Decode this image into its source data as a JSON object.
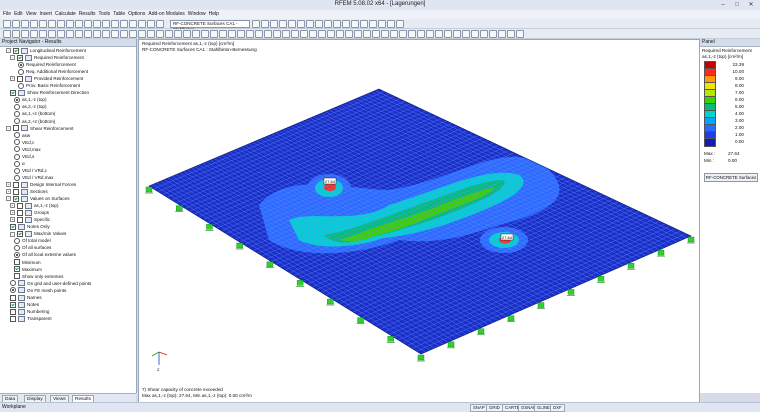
{
  "window": {
    "title": "RFEM 5.08.02 x64 - [Lagerungen]",
    "btn_min": "–",
    "btn_max": "□",
    "btn_close": "✕"
  },
  "menu": [
    "File",
    "Edit",
    "View",
    "Insert",
    "Calculate",
    "Results",
    "Tools",
    "Table",
    "Options",
    "Add-on Modules",
    "Window",
    "Help"
  ],
  "toolbar": {
    "case_combo": "RF-CONCRETE Surfaces CA1 - Stahlbeton"
  },
  "navigator": {
    "title": "Project Navigator - Results",
    "rows": [
      {
        "label": "Longitudinal Reinforcement",
        "kind": "chk",
        "on": true,
        "indent": 1,
        "expand": "−"
      },
      {
        "label": "Required Reinforcement",
        "kind": "chk",
        "on": true,
        "indent": 2,
        "expand": "−"
      },
      {
        "label": "Required Reinforcement",
        "kind": "rad",
        "on": true,
        "indent": 4
      },
      {
        "label": "Req. Additional Reinforcement",
        "kind": "rad",
        "on": false,
        "indent": 4
      },
      {
        "label": "Provided Reinforcement",
        "kind": "chk",
        "on": false,
        "indent": 2,
        "expand": "+"
      },
      {
        "label": "Prov. Basic Reinforcement",
        "kind": "rad",
        "on": false,
        "indent": 4
      },
      {
        "label": "Show Reinforcement Direction",
        "kind": "chk",
        "on": true,
        "indent": 2
      },
      {
        "label": "as,1,-z (top)",
        "kind": "rad",
        "on": true,
        "indent": 3
      },
      {
        "label": "as,2,-z (top)",
        "kind": "rad",
        "on": false,
        "indent": 3
      },
      {
        "label": "as,1,+z (bottom)",
        "kind": "rad",
        "on": false,
        "indent": 3
      },
      {
        "label": "as,2,+z (bottom)",
        "kind": "rad",
        "on": false,
        "indent": 3
      },
      {
        "label": "Shear Reinforcement",
        "kind": "chk",
        "on": false,
        "indent": 1,
        "expand": "−"
      },
      {
        "label": "asw",
        "kind": "rad",
        "on": false,
        "indent": 3
      },
      {
        "label": "VEd,c",
        "kind": "rad",
        "on": false,
        "indent": 3
      },
      {
        "label": "VEd,max",
        "kind": "rad",
        "on": false,
        "indent": 3
      },
      {
        "label": "VEd,s",
        "kind": "rad",
        "on": false,
        "indent": 3
      },
      {
        "label": "α",
        "kind": "rad",
        "on": false,
        "indent": 3
      },
      {
        "label": "VEd / VRd,c",
        "kind": "rad",
        "on": false,
        "indent": 3
      },
      {
        "label": "VEd / VRd,max",
        "kind": "rad",
        "on": false,
        "indent": 3
      },
      {
        "label": "Design Internal Forces",
        "kind": "chk",
        "on": false,
        "indent": 1,
        "expand": "+"
      },
      {
        "label": "Sections",
        "kind": "chk",
        "on": false,
        "indent": 1,
        "expand": "+"
      },
      {
        "label": "Values on Surfaces",
        "kind": "chk",
        "on": true,
        "indent": 1,
        "expand": "−"
      },
      {
        "label": "as,1,-z (top)",
        "kind": "chk",
        "on": false,
        "indent": 2,
        "expand": "+"
      },
      {
        "label": "Groups",
        "kind": "chk",
        "on": false,
        "indent": 2,
        "expand": "+"
      },
      {
        "label": "Specific",
        "kind": "chk",
        "on": false,
        "indent": 2,
        "expand": "+"
      },
      {
        "label": "Notes Only",
        "kind": "chk",
        "on": true,
        "indent": 2
      },
      {
        "label": "Max/min Values",
        "kind": "chk",
        "on": true,
        "indent": 2,
        "expand": "−"
      },
      {
        "label": "Of total model",
        "kind": "rad",
        "on": false,
        "indent": 3
      },
      {
        "label": "Of all surfaces",
        "kind": "rad",
        "on": false,
        "indent": 3
      },
      {
        "label": "Of all local extreme values",
        "kind": "rad",
        "on": true,
        "indent": 3
      },
      {
        "label": "Minimum",
        "kind": "chk",
        "on": false,
        "indent": 3
      },
      {
        "label": "Maximum",
        "kind": "chk",
        "on": true,
        "indent": 3
      },
      {
        "label": "Show only extremes",
        "kind": "chk",
        "on": false,
        "indent": 3
      },
      {
        "label": "On grid and user-defined points",
        "kind": "rad",
        "on": false,
        "indent": 2
      },
      {
        "label": "On FE mesh points",
        "kind": "rad",
        "on": true,
        "indent": 2
      },
      {
        "label": "Names",
        "kind": "chk",
        "on": false,
        "indent": 2
      },
      {
        "label": "Notes",
        "kind": "chk",
        "on": true,
        "indent": 2
      },
      {
        "label": "Numbering",
        "kind": "chk",
        "on": false,
        "indent": 2
      },
      {
        "label": "Transparent",
        "kind": "chk",
        "on": false,
        "indent": 2
      }
    ],
    "tabs": [
      "Data",
      "Display",
      "Views",
      "Results"
    ],
    "active_tab": 3
  },
  "view": {
    "header_line1": "Required Reinforcement as,1,-z (top) [cm²/m]",
    "header_line2": "RF-CONCRETE Surfaces CA1 : Stahlbeton-Bemessung",
    "footer_line1": "7) Shear capacity of concrete exceeded",
    "footer_line2": "Max as,1,-z (top): 27.64, Min as,1,-z (top): 0.00 cm²/m",
    "axis_z": "Z",
    "peak_labels": [
      "27.64",
      "27.64",
      "27.64"
    ]
  },
  "panel": {
    "title": "Panel",
    "heading": "Required Reinforcement",
    "unit": "as,1,-z (top) [cm²/m]",
    "legend": [
      {
        "value": "23.39",
        "color": "#c40000"
      },
      {
        "value": "10.00",
        "color": "#ff2a1a"
      },
      {
        "value": "9.00",
        "color": "#ff9a10"
      },
      {
        "value": "8.00",
        "color": "#f2e600"
      },
      {
        "value": "7.00",
        "color": "#b7e600"
      },
      {
        "value": "6.00",
        "color": "#3cd200"
      },
      {
        "value": "5.00",
        "color": "#00c078"
      },
      {
        "value": "4.00",
        "color": "#00d2d2"
      },
      {
        "value": "3.00",
        "color": "#00a8ff"
      },
      {
        "value": "2.00",
        "color": "#2a6cff"
      },
      {
        "value": "1.00",
        "color": "#1f3fe0"
      },
      {
        "value": "0.00",
        "color": "#0d1fb8"
      }
    ],
    "max_label": "Max :",
    "max_value": "27.64",
    "min_label": "Min :",
    "min_value": "0.00",
    "button": "RF-CONCRETE Surfaces"
  },
  "status": {
    "left": "Workplane",
    "buttons": [
      "SNAP",
      "GRID",
      "CARTES",
      "OSNAP",
      "GLINES",
      "DXF"
    ]
  },
  "colors": {
    "plate_base": "#1830c8",
    "mesh_line": "#6f86ff",
    "support": "#2fd12f"
  }
}
